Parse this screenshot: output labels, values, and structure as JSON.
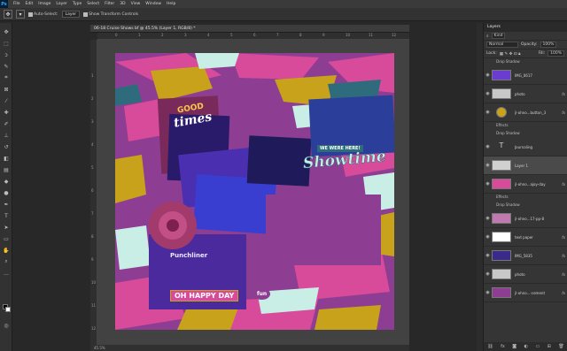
{
  "app": {
    "logo": "Ps"
  },
  "menu": [
    "File",
    "Edit",
    "Image",
    "Layer",
    "Type",
    "Select",
    "Filter",
    "3D",
    "View",
    "Window",
    "Help"
  ],
  "options": {
    "auto_select_label": "Auto-Select:",
    "auto_select_value": "Layer",
    "transform_label": "Show Transform Controls"
  },
  "document": {
    "title": "06-18 Cruise Shows bf @ 45.5% (Layer 1, RGB/8) *",
    "zoom": "45.5%"
  },
  "ruler_top": [
    "0",
    "1",
    "2",
    "3",
    "4",
    "5",
    "6",
    "7",
    "8",
    "9",
    "10",
    "11",
    "12"
  ],
  "ruler_left": [
    "1",
    "2",
    "3",
    "4",
    "5",
    "6",
    "7",
    "8",
    "9",
    "10",
    "11",
    "12"
  ],
  "page": {
    "title_word_1": "GOOD",
    "title_word_2": "times",
    "banner": "WE WERE HERE!",
    "headline": "Showtime",
    "footer_banner": "OH HAPPY DAY",
    "venue_sign": "Punchliner",
    "badge": "fun"
  },
  "panel": {
    "title": "Layers",
    "kind": "Kind",
    "blend": "Normal",
    "opacity_label": "Opacity:",
    "opacity": "100%",
    "lock_label": "Lock:",
    "fill_label": "Fill:",
    "fill": "100%"
  },
  "layers": [
    {
      "name": "Drop Shadow",
      "sub": true
    },
    {
      "name": "IMG_0617",
      "fx": false
    },
    {
      "name": "photo",
      "fx": true
    },
    {
      "name": "jl-ohno...button_3",
      "fx": true
    },
    {
      "name": "Effects",
      "sub": true
    },
    {
      "name": "Drop Shadow",
      "sub": true
    },
    {
      "name": "Journaling",
      "fx": false
    },
    {
      "name": "Layer 1",
      "fx": false
    },
    {
      "name": "jl-ohno...ajoy-day",
      "fx": true
    },
    {
      "name": "Effects",
      "sub": true
    },
    {
      "name": "Drop Shadow",
      "sub": true
    },
    {
      "name": "jl-ohno...17-pp-8",
      "fx": false
    },
    {
      "name": "text paper",
      "fx": true
    },
    {
      "name": "IMG_5835",
      "fx": true
    },
    {
      "name": "photo",
      "fx": true
    },
    {
      "name": "jl-ohno...-cement",
      "fx": true
    }
  ],
  "colors": {
    "pink": "#d84a9a",
    "purple": "#8e3e92",
    "mustard": "#c9a21b",
    "teal": "#2e6c7d",
    "mint": "#c8eee6",
    "accent": "#31a8ff"
  }
}
